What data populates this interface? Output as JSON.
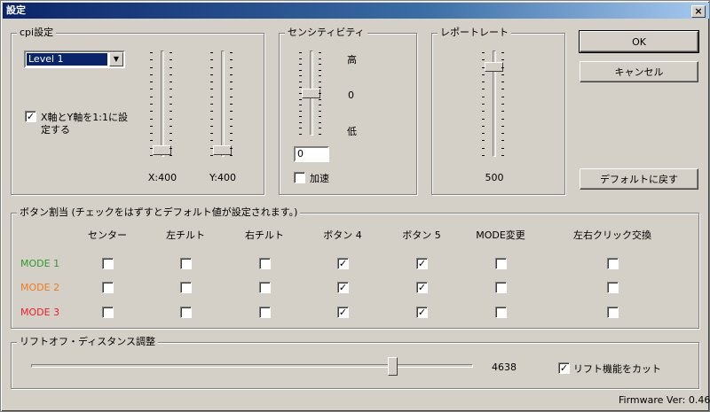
{
  "window": {
    "title": "設定",
    "close_glyph": "×"
  },
  "cpi": {
    "title": "cpi設定",
    "level_select": "Level 1",
    "link_checkbox": {
      "checked": true,
      "label_line1": "X軸とY軸を1:1に設",
      "label_line2": "定する"
    },
    "x_label": "X:400",
    "y_label": "Y:400",
    "x_value": 400,
    "y_value": 400
  },
  "sensitivity": {
    "title": "センシティビティ",
    "high": "高",
    "zero": "0",
    "low": "低",
    "value": "0",
    "accel": {
      "checked": false,
      "label": "加速"
    }
  },
  "report_rate": {
    "title": "レポートレート",
    "value_label": "500",
    "value": 500
  },
  "buttons": {
    "ok": "OK",
    "cancel": "キャンセル",
    "default": "デフォルトに戻す"
  },
  "assignment": {
    "title": "ボタン割当 (チェックをはずすとデフォルト値が設定されます。)",
    "columns": [
      "センター",
      "左チルト",
      "右チルト",
      "ボタン 4",
      "ボタン 5",
      "MODE変更",
      "左右クリック交換"
    ],
    "rows": [
      {
        "label": "MODE 1",
        "color": "#2e9b2e",
        "checks": [
          false,
          false,
          false,
          true,
          true,
          false,
          false
        ]
      },
      {
        "label": "MODE 2",
        "color": "#f07a1a",
        "checks": [
          false,
          false,
          false,
          true,
          true,
          false,
          false
        ]
      },
      {
        "label": "MODE 3",
        "color": "#e8202a",
        "checks": [
          false,
          false,
          false,
          true,
          true,
          false,
          false
        ]
      }
    ]
  },
  "liftoff": {
    "title": "リフトオフ・ディスタンス調整",
    "value_label": "4638",
    "cut": {
      "checked": true,
      "label": "リフト機能をカット"
    }
  },
  "firmware": "Firmware Ver: 0.46"
}
